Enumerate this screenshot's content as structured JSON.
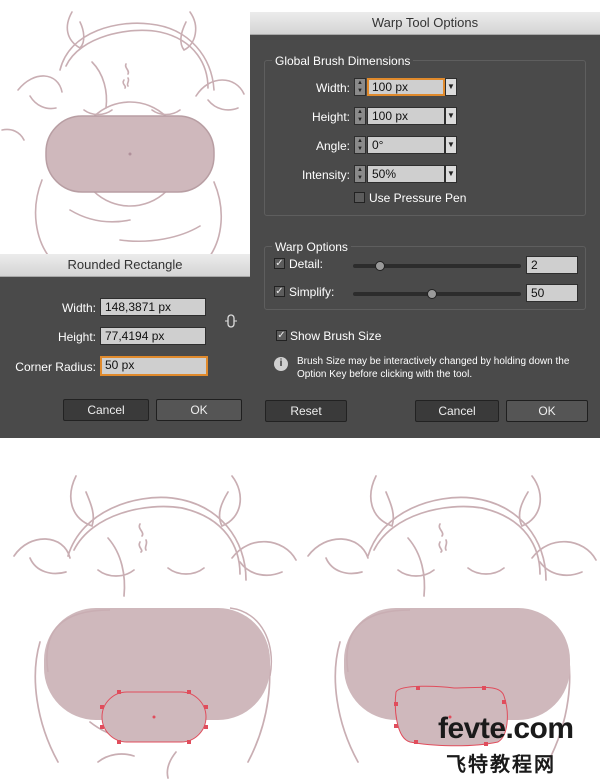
{
  "warp_dialog": {
    "title": "Warp Tool Options",
    "global_group_title": "Global Brush Dimensions",
    "width_label": "Width:",
    "width_value": "100 px",
    "height_label": "Height:",
    "height_value": "100 px",
    "angle_label": "Angle:",
    "angle_value": "0°",
    "intensity_label": "Intensity:",
    "intensity_value": "50%",
    "pressure_label": "Use Pressure Pen",
    "warp_group_title": "Warp Options",
    "detail_label": "Detail:",
    "detail_value": "2",
    "simplify_label": "Simplify:",
    "simplify_value": "50",
    "show_brush_label": "Show Brush Size",
    "note_line1": "Brush Size may be interactively changed by holding down the",
    "note_line2": "Option Key before clicking with the tool.",
    "reset_label": "Reset",
    "cancel_label": "Cancel",
    "ok_label": "OK",
    "detail_level": 0.14,
    "simplify_level": 0.47
  },
  "rect_dialog": {
    "title": "Rounded Rectangle",
    "width_label": "Width:",
    "width_value": "148,3871 px",
    "height_label": "Height:",
    "height_value": "77,4194 px",
    "corner_label": "Corner Radius:",
    "corner_value": "50 px",
    "cancel_label": "Cancel",
    "ok_label": "OK"
  },
  "watermark": {
    "line1": "fevte.com",
    "line2": "飞特教程网"
  },
  "colors": {
    "sketch": "#c9aeb3",
    "fill": "#cfb8bc",
    "selection": "#e04d5c",
    "dialog_bg": "#4a4a4a",
    "focus": "#e08a2c"
  }
}
